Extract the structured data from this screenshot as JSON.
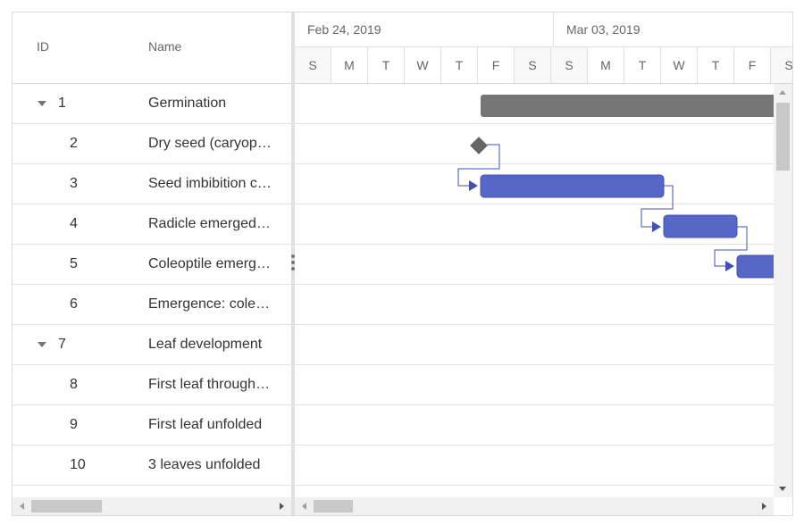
{
  "grid": {
    "columns": {
      "id": "ID",
      "name": "Name"
    },
    "rows": [
      {
        "id": "1",
        "name": "Germination",
        "expanded": true
      },
      {
        "id": "2",
        "name": "Dry seed (caryopsis)"
      },
      {
        "id": "3",
        "name": "Seed imbibition complete"
      },
      {
        "id": "4",
        "name": "Radicle emerged from caryopsis"
      },
      {
        "id": "5",
        "name": "Coleoptile emerged from caryopsis"
      },
      {
        "id": "6",
        "name": "Emergence: coleoptile penetrates soil surface"
      },
      {
        "id": "7",
        "name": "Leaf development",
        "expanded": true
      },
      {
        "id": "8",
        "name": "First leaf through coleoptile"
      },
      {
        "id": "9",
        "name": "First leaf unfolded"
      },
      {
        "id": "10",
        "name": "3 leaves unfolded"
      }
    ]
  },
  "timeline": {
    "weeks": [
      "Feb 24, 2019",
      "Mar 03, 2019"
    ],
    "days": [
      "S",
      "M",
      "T",
      "W",
      "T",
      "F",
      "S",
      "S",
      "M",
      "T",
      "W",
      "T",
      "F",
      "S"
    ]
  },
  "colors": {
    "summary_bar": "#757575",
    "task_bar": "#5767c8",
    "task_bar_border": "#3f51b5",
    "milestone": "#666666",
    "connector": "#3f51b5"
  },
  "icons": {
    "expand": "chevron-down-icon",
    "splitter": "more-vertical-icon"
  }
}
